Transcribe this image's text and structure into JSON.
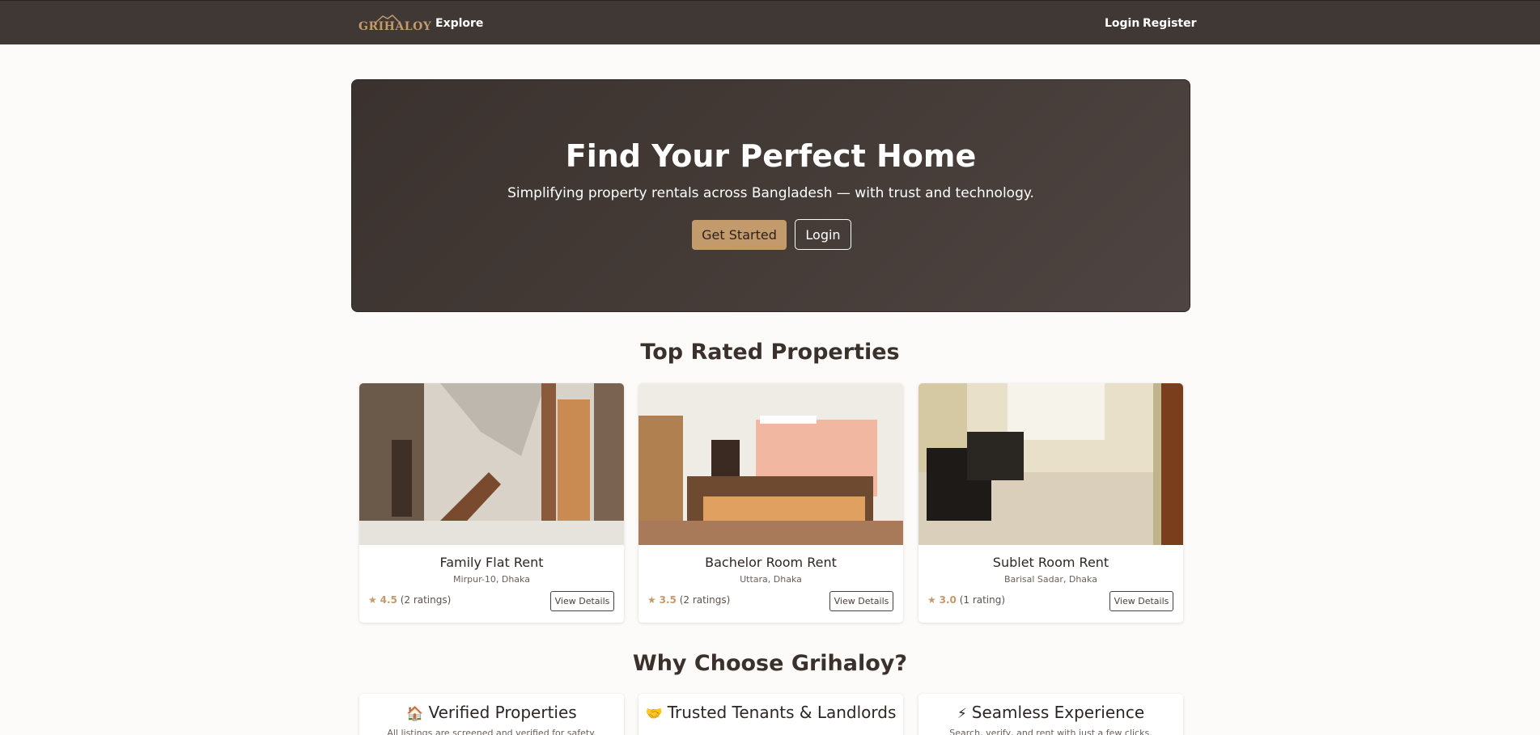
{
  "nav": {
    "brand": "GRIHALOY",
    "explore": "Explore",
    "login": "Login",
    "register": "Register"
  },
  "hero": {
    "title": "Find Your Perfect Home",
    "subtitle": "Simplifying property rentals across Bangladesh — with trust and technology.",
    "get_started": "Get Started",
    "login": "Login"
  },
  "top_rated": {
    "title": "Top Rated Properties",
    "cards": [
      {
        "title": "Family Flat Rent",
        "location": "Mirpur-10, Dhaka",
        "rating": "4.5",
        "ratings_count": "(2 ratings)",
        "button": "View Details"
      },
      {
        "title": "Bachelor Room Rent",
        "location": "Uttara, Dhaka",
        "rating": "3.5",
        "ratings_count": "(2 ratings)",
        "button": "View Details"
      },
      {
        "title": "Sublet Room Rent",
        "location": "Barisal Sadar, Dhaka",
        "rating": "3.0",
        "ratings_count": "(1 rating)",
        "button": "View Details"
      }
    ]
  },
  "why": {
    "title": "Why Choose Grihaloy?",
    "features": [
      {
        "icon": "house-icon",
        "glyph": "🏠",
        "title": "Verified Properties",
        "desc": "All listings are screened and verified for safety."
      },
      {
        "icon": "handshake-icon",
        "glyph": "🤝",
        "title": "Trusted Tenants & Landlords",
        "desc": ""
      },
      {
        "icon": "lightning-icon",
        "glyph": "⚡",
        "title": "Seamless Experience",
        "desc": "Search, verify, and rent with just a few clicks."
      }
    ]
  },
  "colors": {
    "nav_bg": "#403834",
    "accent": "#c39a6b",
    "hero_bg": "#443b37"
  }
}
